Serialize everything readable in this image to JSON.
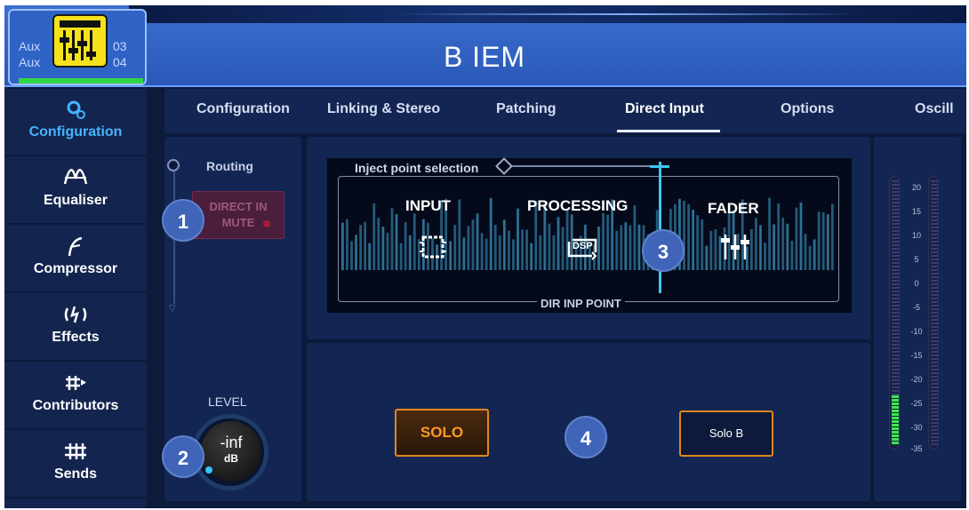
{
  "header": {
    "aux_line1": "Aux",
    "aux_line2": "Aux",
    "aux_num1": "03",
    "aux_num2": "04",
    "title": "B IEM",
    "icon": "fader-icon",
    "accent": "#f5e21c"
  },
  "sidebar": {
    "items": [
      {
        "label": "Configuration",
        "icon": "gear-icon",
        "active": true
      },
      {
        "label": "Equaliser",
        "icon": "eq-icon"
      },
      {
        "label": "Compressor",
        "icon": "compressor-icon"
      },
      {
        "label": "Effects",
        "icon": "effects-icon"
      },
      {
        "label": "Contributors",
        "icon": "contributors-icon"
      },
      {
        "label": "Sends",
        "icon": "sends-icon"
      }
    ]
  },
  "tabs": [
    {
      "label": "Configuration"
    },
    {
      "label": "Linking & Stereo"
    },
    {
      "label": "Patching"
    },
    {
      "label": "Direct Input",
      "active": true
    },
    {
      "label": "Options"
    },
    {
      "label": "Oscill"
    }
  ],
  "routing": {
    "label": "Routing",
    "mute_line1": "DIRECT IN",
    "mute_line2": "MUTE"
  },
  "level": {
    "label": "LEVEL",
    "value": "-inf",
    "unit": "dB"
  },
  "inject": {
    "label": "Inject point selection",
    "sections": [
      "INPUT",
      "PROCESSING",
      "FADER"
    ],
    "dsp_text": "DSP",
    "bottom_label": "DIR INP POINT"
  },
  "solo": {
    "solo_label": "SOLO",
    "solob_label": "Solo B"
  },
  "badges": [
    "1",
    "2",
    "3",
    "4"
  ],
  "meter": {
    "scale": [
      "20",
      "15",
      "10",
      "5",
      "0",
      "-5",
      "-10",
      "-15",
      "-20",
      "-25",
      "-30",
      "-35"
    ]
  },
  "colors": {
    "accent_blue": "#43b4ff",
    "solo_orange": "#e0871c",
    "meter_green": "#3ae84a"
  }
}
